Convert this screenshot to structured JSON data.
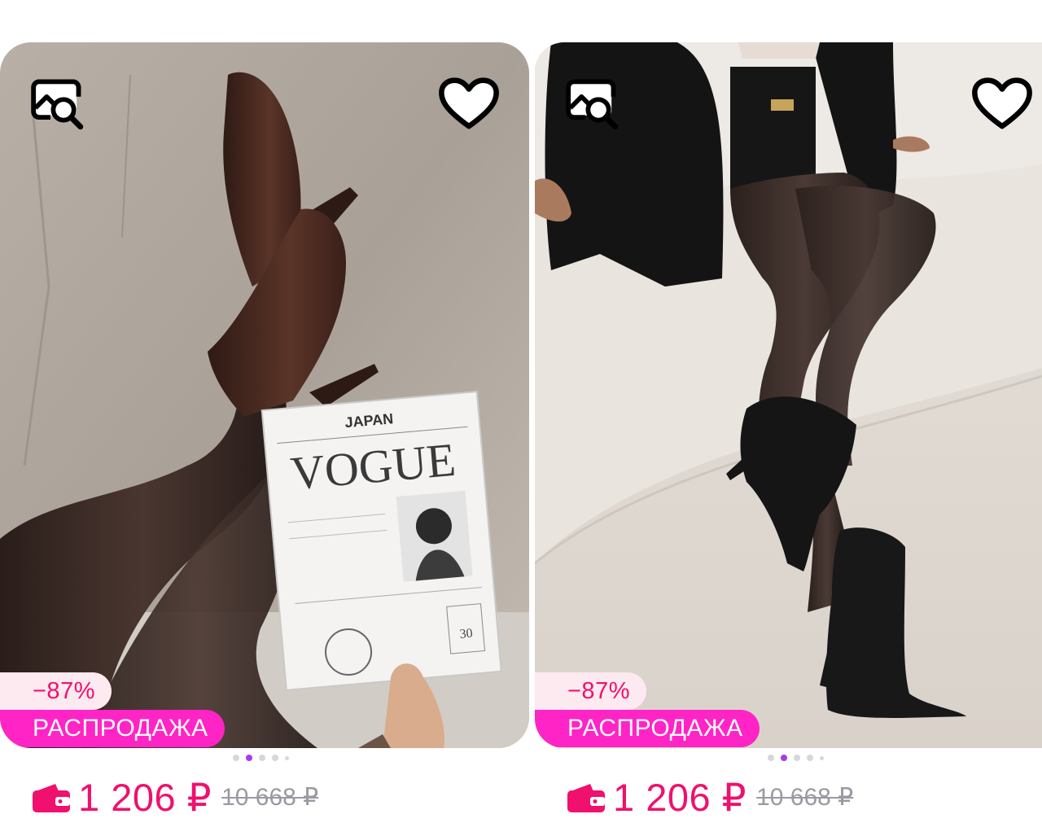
{
  "products": [
    {
      "discount": "−87%",
      "sale_label": "РАСПРОДАЖА",
      "price": "1 206 ₽",
      "old_price": "10 668 ₽",
      "image_icons": [
        "visual-search-icon",
        "heart-icon"
      ],
      "magazine": {
        "country": "JAPAN",
        "title": "VOGUE",
        "issue": "30"
      },
      "carousel": {
        "count": 5,
        "active": 2
      }
    },
    {
      "discount": "−87%",
      "sale_label": "РАСПРОДАЖА",
      "price": "1 206 ₽",
      "old_price": "10 668 ₽",
      "image_icons": [
        "visual-search-icon",
        "heart-icon"
      ],
      "carousel": {
        "count": 5,
        "active": 2
      }
    }
  ],
  "colors": {
    "price": "#f0106d",
    "discount_bg": "#fde9f0",
    "sale_bg": "#ff24c5",
    "dot_active": "#a23cf0",
    "dot_inactive": "#d6d6dc",
    "old_price": "#9a9aa2"
  }
}
